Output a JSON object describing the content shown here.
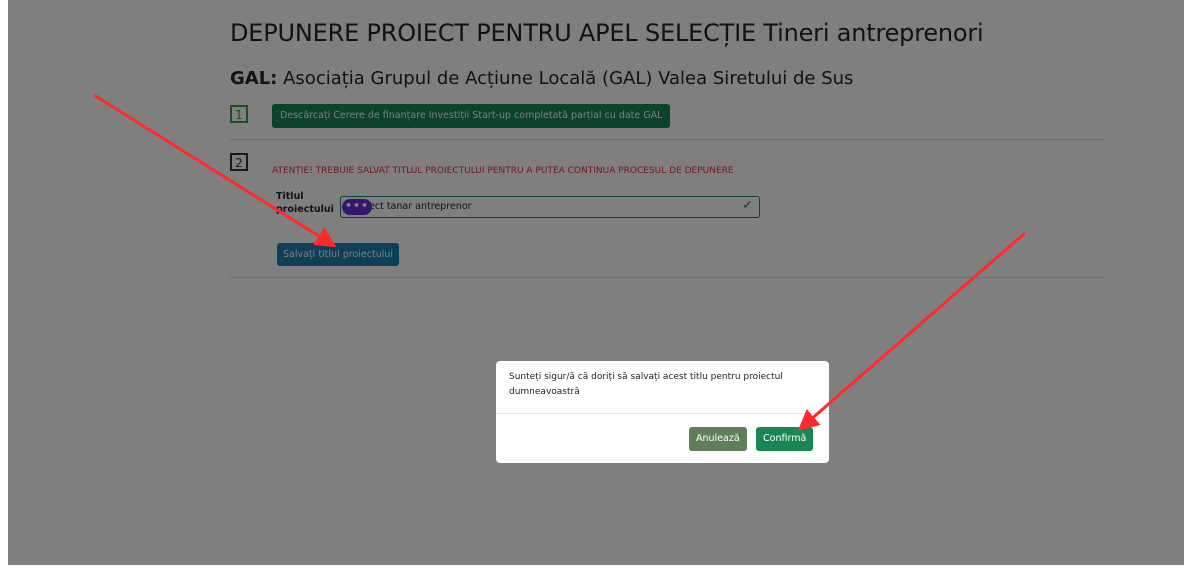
{
  "page": {
    "title": "DEPUNERE PROIECT PENTRU APEL SELECȚIE Tineri antreprenori",
    "gal_prefix": "GAL:",
    "gal_name": "Asociația Grupul de Acțiune Locală (GAL) Valea Siretului de Sus"
  },
  "step1": {
    "number": "1",
    "button_label": "Descărcați Cerere de finanțare Investiții Start-up completată parțial cu date GAL"
  },
  "step2": {
    "number": "2",
    "warning": "ATENȚIE! TREBUIE SALVAT TITLUL PROIECTULUI PENTRU A PUTEA CONTINUA PROCESUL DE DEPUNERE",
    "field_label": "Titlul proiectului",
    "field_value": "ect tanar antreprenor",
    "save_button": "Salvați titlul proiectului"
  },
  "grammarly": {
    "label": "•••"
  },
  "modal": {
    "message": "Sunteți sigur/ă că doriți să salvați acest titlu pentru proiectul dumneavoastră",
    "cancel": "Anulează",
    "confirm": "Confirmă"
  },
  "colors": {
    "success": "#198754",
    "danger": "#dc3545",
    "annotation_arrow": "#ff2a2a"
  }
}
